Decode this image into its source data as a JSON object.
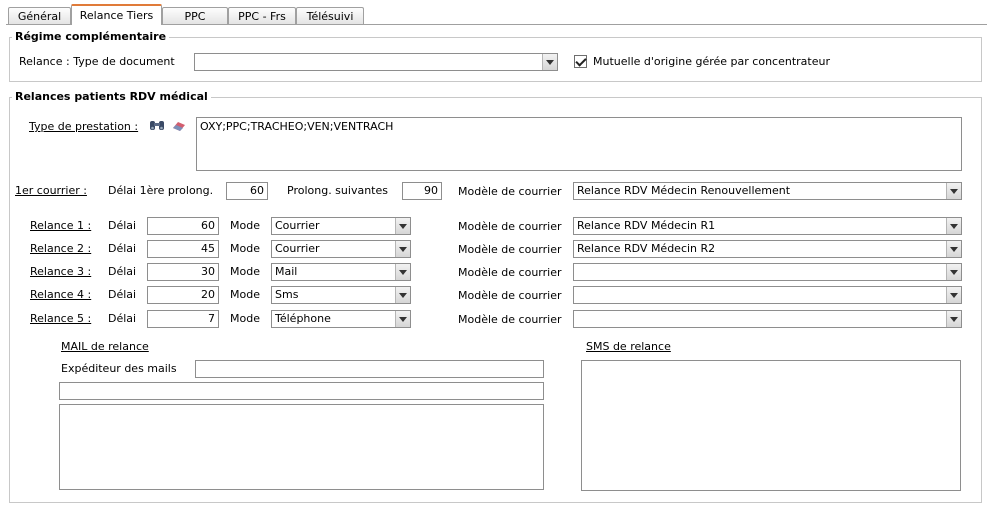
{
  "tabs": [
    "Général",
    "Relance Tiers",
    "PPC",
    "PPC - Frs",
    "Télésuivi"
  ],
  "active_tab": "Relance Tiers",
  "regime": {
    "legend": "Régime complémentaire",
    "type_doc_label": "Relance : Type de document",
    "type_doc_value": "",
    "mutuelle_label": "Mutuelle d'origine gérée par concentrateur",
    "mutuelle_checked": true
  },
  "relances": {
    "legend": "Relances patients RDV médical",
    "prestation_label": "Type de prestation :",
    "prestation_value": "OXY;PPC;TRACHEO;VEN;VENTRACH",
    "icons": [
      "binoculars-icon",
      "eraser-icon"
    ],
    "first": {
      "label": "1er courrier :",
      "delai_label": "Délai 1ère prolong.",
      "delai_value": "60",
      "suiv_label": "Prolong. suivantes",
      "suiv_value": "90",
      "modele_label": "Modèle de courrier",
      "modele_value": "Relance RDV Médecin Renouvellement"
    },
    "delai_label": "Délai",
    "mode_label": "Mode",
    "modele_label": "Modèle de courrier",
    "rows": [
      {
        "label": "Relance 1 :",
        "delai": "60",
        "mode": "Courrier",
        "modele": "Relance RDV Médecin R1"
      },
      {
        "label": "Relance 2 :",
        "delai": "45",
        "mode": "Courrier",
        "modele": "Relance RDV Médecin R2"
      },
      {
        "label": "Relance 3 :",
        "delai": "30",
        "mode": "Mail",
        "modele": ""
      },
      {
        "label": "Relance 4 :",
        "delai": "20",
        "mode": "Sms",
        "modele": ""
      },
      {
        "label": "Relance 5 :",
        "delai": "7",
        "mode": "Téléphone",
        "modele": ""
      }
    ],
    "mail": {
      "title": "MAIL de relance",
      "sender_label": "Expéditeur des mails",
      "sender_value": "",
      "subject_value": "",
      "body_value": ""
    },
    "sms": {
      "title": "SMS de relance",
      "body_value": ""
    }
  },
  "colors": {
    "active_tab_accent": "#e07b39",
    "border": "#c8c8c8"
  }
}
